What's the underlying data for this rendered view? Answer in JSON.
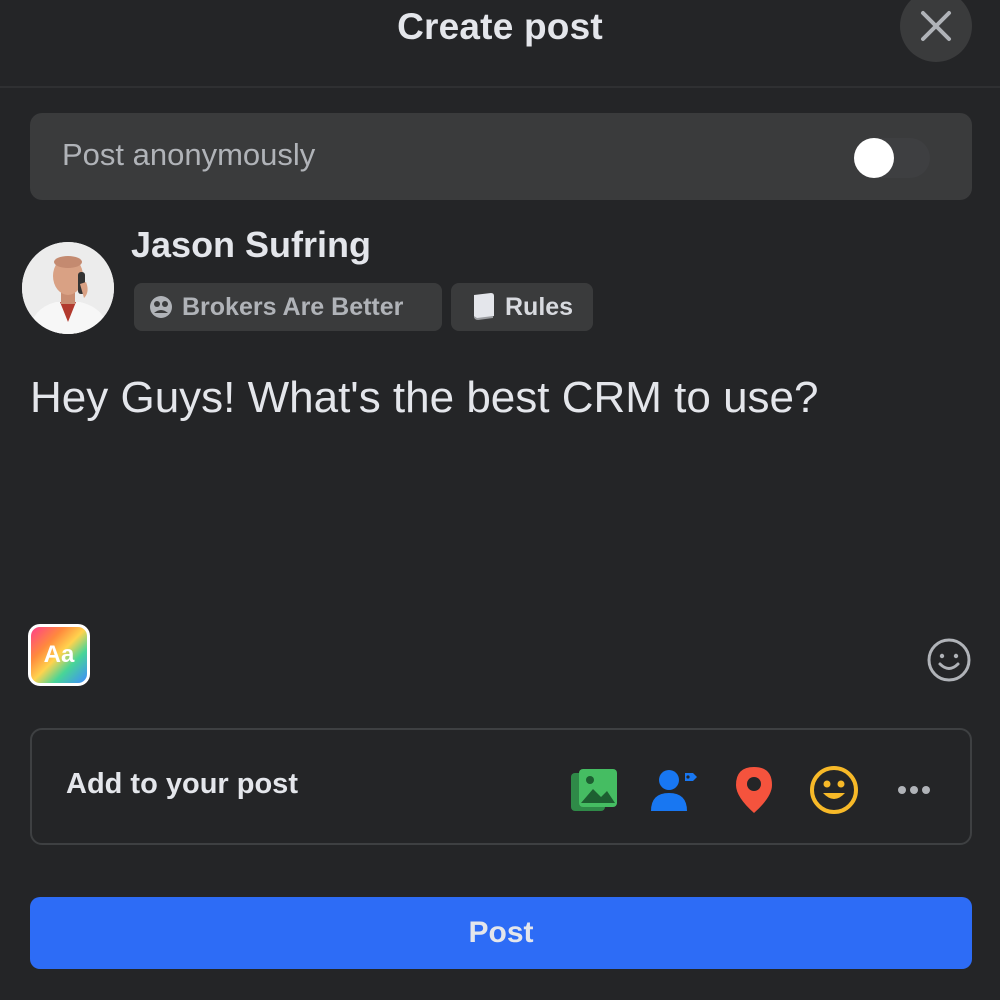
{
  "header": {
    "title": "Create post",
    "close_icon": "close-icon"
  },
  "anonymous": {
    "label": "Post anonymously",
    "enabled": false
  },
  "user": {
    "name": "Jason Sufring"
  },
  "audience": {
    "group_label": "Brokers Are Better",
    "group_icon": "group-icon",
    "rules_label": "Rules",
    "rules_icon": "book-icon"
  },
  "composer": {
    "text": "Hey Guys! What's the best CRM to use?"
  },
  "format": {
    "aa_label": "Aa",
    "emoji_icon": "smiley-icon"
  },
  "add_to_post": {
    "label": "Add to your post",
    "icons": [
      "photo-icon",
      "tag-people-icon",
      "location-icon",
      "feeling-icon",
      "more-icon"
    ],
    "colors": {
      "photo": "#45bd62",
      "tag": "#1877f2",
      "location": "#f5533d",
      "feeling": "#f7b928"
    }
  },
  "post_button": {
    "label": "Post",
    "color": "#2d6cf6"
  }
}
